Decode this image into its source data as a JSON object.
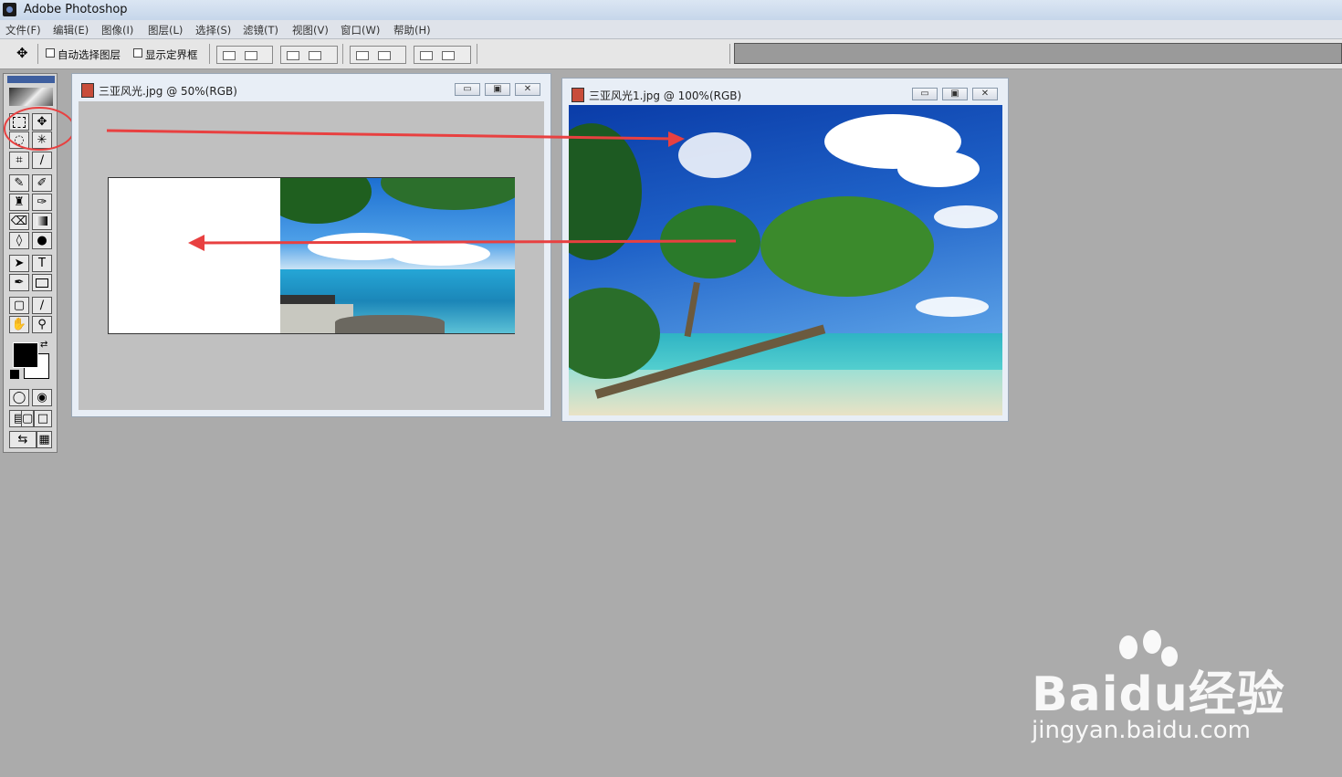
{
  "app": {
    "title": "Adobe Photoshop"
  },
  "menu": [
    "文件(F)",
    "编辑(E)",
    "图像(I)",
    "图层(L)",
    "选择(S)",
    "滤镜(T)",
    "视图(V)",
    "窗口(W)",
    "帮助(H)"
  ],
  "options": {
    "auto_select_label": "自动选择图层",
    "show_bounds_label": "显示定界框"
  },
  "doc1": {
    "title": "三亚风光.jpg @ 50%(RGB)"
  },
  "doc2": {
    "title": "三亚风光1.jpg @ 100%(RGB)"
  },
  "tools": {
    "move": "✥",
    "lasso": "◌",
    "wand": "✳",
    "crop": "⌗",
    "eyedrop": "∕",
    "text": "T",
    "hand": "✋",
    "zoom": "🔍"
  },
  "window_buttons": {
    "min": "▭",
    "restore": "▣",
    "close": "✕"
  },
  "watermark": {
    "brand": "Baidu经验",
    "url": "jingyan.baidu.com"
  },
  "colors": {
    "accent": "#e84040",
    "foreground": "#000000",
    "background": "#ffffff"
  }
}
